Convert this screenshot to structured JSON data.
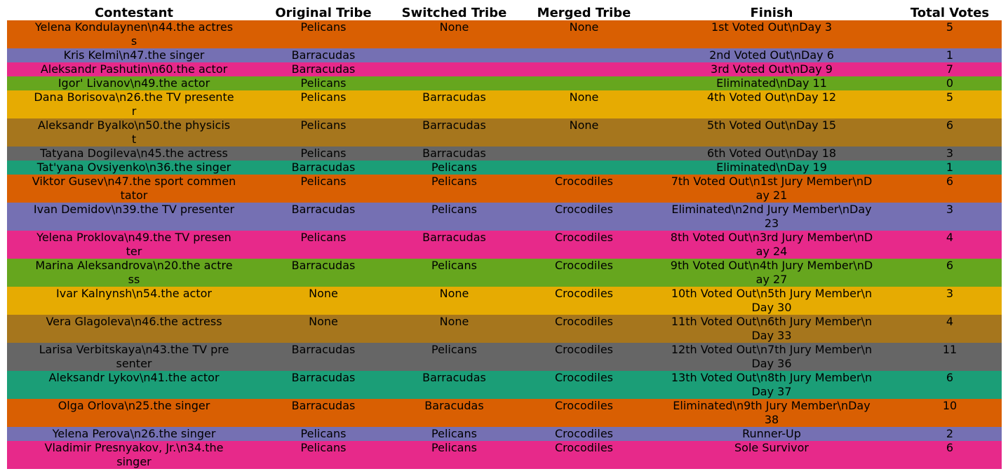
{
  "chart_data": {
    "type": "table",
    "columns": [
      "Contestant",
      "Original Tribe",
      "Switched Tribe",
      "Merged Tribe",
      "Finish",
      "Total Votes"
    ],
    "palette": [
      "#d95f02",
      "#7570b3",
      "#e7298a",
      "#66a61e",
      "#e6ab02",
      "#a6761d",
      "#666666",
      "#1b9e77"
    ],
    "rows": [
      {
        "cells": [
          "Yelena Kondulaynen\\n44.the actres\ns",
          "Pelicans",
          "None",
          "None",
          "1st Voted Out\\nDay 3",
          "5"
        ],
        "color": "#d95f02"
      },
      {
        "cells": [
          "Kris Kelmi\\n47.the singer",
          "Barracudas",
          "",
          "",
          "2nd Voted Out\\nDay 6",
          "1"
        ],
        "color": "#7570b3"
      },
      {
        "cells": [
          "Aleksandr Pashutin\\n60.the actor",
          "Barracudas",
          "",
          "",
          "3rd Voted Out\\nDay 9",
          "7"
        ],
        "color": "#e7298a"
      },
      {
        "cells": [
          "Igor' Livanov\\n49.the actor",
          "Pelicans",
          "",
          "",
          "Eliminated\\nDay 11",
          "0"
        ],
        "color": "#66a61e"
      },
      {
        "cells": [
          "Dana Borisova\\n26.the TV presente\nr",
          "Pelicans",
          "Barracudas",
          "None",
          "4th Voted Out\\nDay 12",
          "5"
        ],
        "color": "#e6ab02"
      },
      {
        "cells": [
          "Aleksandr Byalko\\n50.the physicis\nt",
          "Pelicans",
          "Barracudas",
          "None",
          "5th Voted Out\\nDay 15",
          "6"
        ],
        "color": "#a6761d"
      },
      {
        "cells": [
          "Tatyana Dogileva\\n45.the actress",
          "Pelicans",
          "Barracudas",
          "",
          "6th Voted Out\\nDay 18",
          "3"
        ],
        "color": "#666666"
      },
      {
        "cells": [
          "Tat'yana Ovsiyenko\\n36.the singer",
          "Barracudas",
          "Pelicans",
          "",
          "Eliminated\\nDay 19",
          "1"
        ],
        "color": "#1b9e77"
      },
      {
        "cells": [
          "Viktor Gusev\\n47.the sport commen\ntator",
          "Pelicans",
          "Pelicans",
          "Crocodiles",
          "7th Voted Out\\n1st Jury Member\\nD\nay 21",
          "6"
        ],
        "color": "#d95f02"
      },
      {
        "cells": [
          "Ivan Demidov\\n39.the TV presenter",
          "Barracudas",
          "Pelicans",
          "Crocodiles",
          "Eliminated\\n2nd Jury Member\\nDay\n23",
          "3"
        ],
        "color": "#7570b3"
      },
      {
        "cells": [
          "Yelena Proklova\\n49.the TV presen\nter",
          "Pelicans",
          "Barracudas",
          "Crocodiles",
          "8th Voted Out\\n3rd Jury Member\\nD\nay 24",
          "4"
        ],
        "color": "#e7298a"
      },
      {
        "cells": [
          "Marina Aleksandrova\\n20.the actre\nss",
          "Barracudas",
          "Pelicans",
          "Crocodiles",
          "9th Voted Out\\n4th Jury Member\\nD\nay 27",
          "6"
        ],
        "color": "#66a61e"
      },
      {
        "cells": [
          "Ivar Kalnynsh\\n54.the actor",
          "None",
          "None",
          "Crocodiles",
          "10th Voted Out\\n5th Jury Member\\n\nDay 30",
          "3"
        ],
        "color": "#e6ab02"
      },
      {
        "cells": [
          "Vera Glagoleva\\n46.the actress",
          "None",
          "None",
          "Crocodiles",
          "11th Voted Out\\n6th Jury Member\\n\nDay 33",
          "4"
        ],
        "color": "#a6761d"
      },
      {
        "cells": [
          "Larisa Verbitskaya\\n43.the TV pre\nsenter",
          "Barracudas",
          "Pelicans",
          "Crocodiles",
          "12th Voted Out\\n7th Jury Member\\n\nDay 36",
          "11"
        ],
        "color": "#666666"
      },
      {
        "cells": [
          "Aleksandr Lykov\\n41.the actor",
          "Barracudas",
          "Barracudas",
          "Crocodiles",
          "13th Voted Out\\n8th Jury Member\\n\nDay 37",
          "6"
        ],
        "color": "#1b9e77"
      },
      {
        "cells": [
          "Olga Orlova\\n25.the singer",
          "Barracudas",
          "Baracudas",
          "Crocodiles",
          "Eliminated\\n9th Jury Member\\nDay\n38",
          "10"
        ],
        "color": "#d95f02"
      },
      {
        "cells": [
          "Yelena Perova\\n26.the singer",
          "Pelicans",
          "Pelicans",
          "Crocodiles",
          "Runner-Up",
          "2"
        ],
        "color": "#7570b3"
      },
      {
        "cells": [
          "Vladimir Presnyakov, Jr.\\n34.the\nsinger",
          "Pelicans",
          "Pelicans",
          "Crocodiles",
          "Sole Survivor",
          "6"
        ],
        "color": "#e7298a"
      }
    ]
  }
}
